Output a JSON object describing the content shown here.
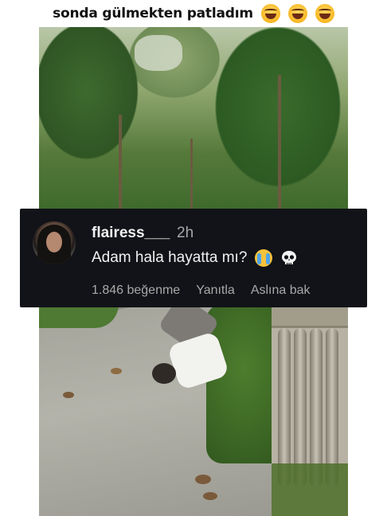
{
  "caption": {
    "text": "sonda gülmekten patladım",
    "emojis": [
      "laughing-emoji",
      "laughing-emoji",
      "laughing-emoji"
    ]
  },
  "comment": {
    "username": "flairess___",
    "time": "2h",
    "text": "Adam hala hayatta mı?",
    "emojis": [
      "crying-emoji",
      "skull-emoji"
    ],
    "likes": "1.846 beğenme",
    "reply_label": "Yanıtla",
    "see_original_label": "Aslına bak",
    "colors": {
      "background": "#111318",
      "primary_text": "#f1f1f1",
      "secondary_text": "#a8a8a8"
    }
  }
}
